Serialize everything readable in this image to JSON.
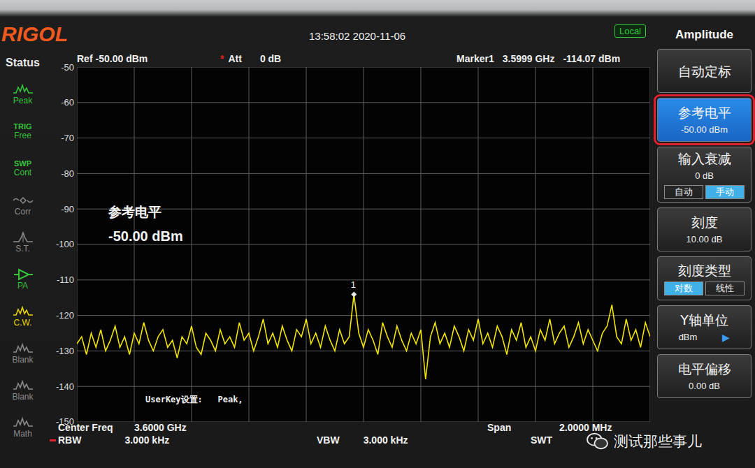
{
  "topbar": {
    "logo": "RIGOL",
    "time": "13:58:02 2020-11-06",
    "badge": "Local"
  },
  "infobar": {
    "ref": {
      "label": "Ref",
      "value": "-50.00 dBm"
    },
    "att": {
      "mark": "*",
      "label": "Att",
      "value": "0 dB"
    },
    "marker": {
      "label": "Marker1",
      "freq": "3.5999 GHz",
      "level": "-114.07 dBm"
    }
  },
  "status": {
    "title": "Status",
    "items": [
      {
        "kind": "wave",
        "label": "Peak",
        "color": "#35c43a"
      },
      {
        "kind": "text",
        "top": "TRIG",
        "label": "Free",
        "color": "#35c43a"
      },
      {
        "kind": "text",
        "top": "SWP",
        "label": "Cont",
        "color": "#35c43a"
      },
      {
        "kind": "corr",
        "label": "Corr",
        "color": "#8a8a8a"
      },
      {
        "kind": "spike",
        "label": "S.T.",
        "color": "#8a8a8a"
      },
      {
        "kind": "pa",
        "label": "PA",
        "color": "#35c43a"
      },
      {
        "kind": "wave",
        "label": "C.W.",
        "color": "#e8d400"
      },
      {
        "kind": "wave",
        "label": "Blank",
        "color": "#8a8a8a"
      },
      {
        "kind": "wave",
        "label": "Blank",
        "color": "#8a8a8a"
      },
      {
        "kind": "wave",
        "label": "Math",
        "color": "#8a8a8a"
      }
    ]
  },
  "plot": {
    "ticks": [
      "-50",
      "-60",
      "-70",
      "-80",
      "-90",
      "-100",
      "-110",
      "-120",
      "-130",
      "-140",
      "-150"
    ],
    "trace": [
      -128,
      -126,
      -131,
      -125,
      -129,
      -124,
      -130,
      -127,
      -123,
      -129,
      -126,
      -131,
      -125,
      -128,
      -122,
      -127,
      -130,
      -126,
      -124,
      -129,
      -127,
      -132,
      -126,
      -128,
      -123,
      -129,
      -131,
      -125,
      -127,
      -130,
      -124,
      -128,
      -126,
      -129,
      -122,
      -127,
      -125,
      -130,
      -126,
      -121,
      -128,
      -125,
      -129,
      -123,
      -127,
      -130,
      -124,
      -126,
      -121,
      -128,
      -125,
      -129,
      -123,
      -127,
      -130,
      -124,
      -128,
      -126,
      -114.07,
      -125,
      -129,
      -124,
      -127,
      -131,
      -122,
      -126,
      -129,
      -123,
      -127,
      -130,
      -125,
      -128,
      -124,
      -138,
      -126,
      -122,
      -128,
      -125,
      -129,
      -123,
      -126,
      -130,
      -124,
      -127,
      -121,
      -128,
      -125,
      -129,
      -123,
      -126,
      -131,
      -124,
      -127,
      -122,
      -129,
      -126,
      -130,
      -124,
      -127,
      -121,
      -128,
      -125,
      -123,
      -129,
      -126,
      -122,
      -128,
      -124,
      -127,
      -130,
      -125,
      -123,
      -117,
      -126,
      -128,
      -121,
      -127,
      -124,
      -129,
      -122,
      -126
    ],
    "marker": {
      "label": "1",
      "index": 58
    },
    "overlay": {
      "title": "参考电平",
      "value": "-50.00 dBm"
    },
    "userkey": "UserKey设置:   Peak,"
  },
  "bottom": {
    "row1": [
      {
        "label": "Center Freq",
        "value": "3.6000 GHz",
        "flag": false
      },
      {
        "label": "Span",
        "value": "2.0000 MHz",
        "flag": false
      }
    ],
    "row2": [
      {
        "label": "RBW",
        "value": "3.000 kHz",
        "flag": true
      },
      {
        "label": "VBW",
        "value": "3.000 kHz",
        "flag": false
      },
      {
        "label": "SWT",
        "flag": false
      }
    ]
  },
  "menu": {
    "title": "Amplitude",
    "buttons": [
      {
        "kind": "plain",
        "label": "自动定标",
        "selected": false
      },
      {
        "kind": "value",
        "label": "参考电平",
        "value": "-50.00 dBm",
        "selected": true
      },
      {
        "kind": "toggle",
        "label": "输入衰减",
        "value": "0 dB",
        "options": [
          {
            "label": "自动",
            "selected": false
          },
          {
            "label": "手动",
            "selected": true
          }
        ],
        "selected": false
      },
      {
        "kind": "value",
        "label": "刻度",
        "value": "10.00 dB",
        "selected": false
      },
      {
        "kind": "toggle",
        "label": "刻度类型",
        "options": [
          {
            "label": "对数",
            "selected": true
          },
          {
            "label": "线性",
            "selected": false
          }
        ],
        "selected": false
      },
      {
        "kind": "arrow",
        "label": "Y轴单位",
        "value": "dBm",
        "arrow": "▶",
        "selected": false
      },
      {
        "kind": "value",
        "label": "电平偏移",
        "value": "0.00 dB",
        "selected": false
      }
    ]
  },
  "watermark": "测试那些事儿"
}
